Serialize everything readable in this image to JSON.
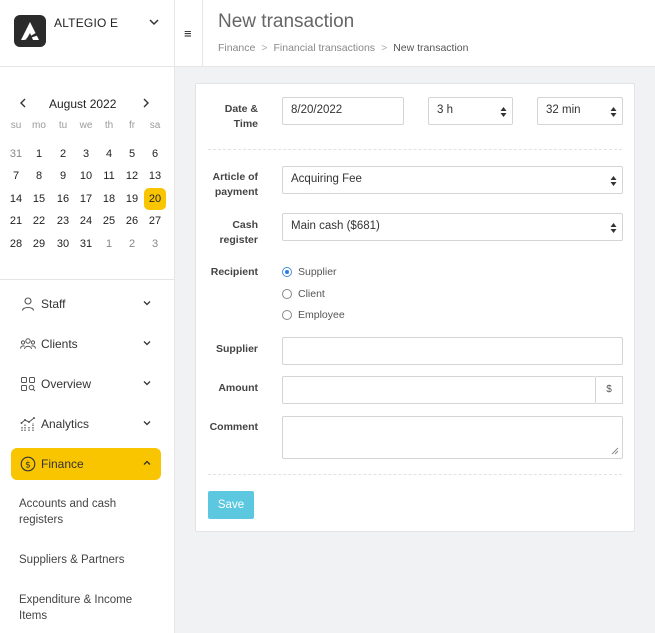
{
  "brand": {
    "name": "ALTEGIO E",
    "logo_icon": "altegio-logo-icon"
  },
  "calendar": {
    "month_label": "August 2022",
    "days_of_week": [
      "su",
      "mo",
      "tu",
      "we",
      "th",
      "fr",
      "sa"
    ],
    "weeks": [
      [
        "31",
        "1",
        "2",
        "3",
        "4",
        "5",
        "6"
      ],
      [
        "7",
        "8",
        "9",
        "10",
        "11",
        "12",
        "13"
      ],
      [
        "14",
        "15",
        "16",
        "17",
        "18",
        "19",
        "20"
      ],
      [
        "21",
        "22",
        "23",
        "24",
        "25",
        "26",
        "27"
      ],
      [
        "28",
        "29",
        "30",
        "31",
        "1",
        "2",
        "3"
      ]
    ],
    "selected_day": "20",
    "selected_color": "#f9c400"
  },
  "nav": {
    "items": [
      {
        "label": "Staff",
        "icon": "person-icon"
      },
      {
        "label": "Clients",
        "icon": "clients-icon"
      },
      {
        "label": "Overview",
        "icon": "overview-icon"
      },
      {
        "label": "Analytics",
        "icon": "analytics-icon"
      },
      {
        "label": "Finance",
        "icon": "dollar-icon",
        "active": true
      }
    ],
    "finance_subitems": [
      "Accounts and cash registers",
      "Suppliers & Partners",
      "Expenditure & Income Items"
    ],
    "active_color": "#f9c400"
  },
  "header": {
    "menu_glyph": "≡",
    "title": "New transaction",
    "breadcrumb": [
      "Finance",
      "Financial transactions",
      "New transaction"
    ],
    "breadcrumb_separator": ">"
  },
  "form": {
    "date_time_label": "Date & Time",
    "date_value": "8/20/2022",
    "hour_value": "3 h",
    "minute_value": "32 min",
    "article_label": "Article of payment",
    "article_value": "Acquiring Fee",
    "cash_register_label": "Cash register",
    "cash_register_value": "Main cash ($681)",
    "recipient_label": "Recipient",
    "recipient_options": [
      "Supplier",
      "Client",
      "Employee"
    ],
    "recipient_selected": "Supplier",
    "supplier_label": "Supplier",
    "supplier_value": "",
    "amount_label": "Amount",
    "amount_value": "",
    "currency_symbol": "$",
    "comment_label": "Comment",
    "comment_value": "",
    "save_label": "Save",
    "save_color": "#5bc8e0"
  }
}
